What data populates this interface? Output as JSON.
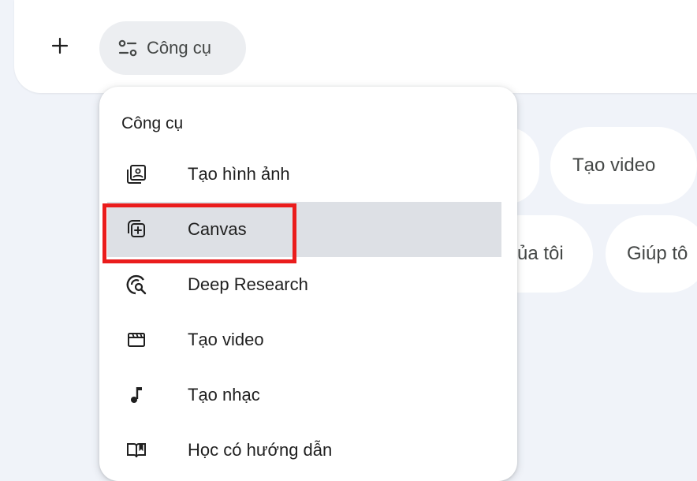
{
  "composer": {
    "plus_icon": "plus-icon",
    "tools_chip": {
      "icon": "tune-icon",
      "label": "Công cụ"
    }
  },
  "suggestions": [
    {
      "label": ""
    },
    {
      "label": "Tạo video"
    },
    {
      "label": "ủa tôi"
    },
    {
      "label": "Giúp tô"
    }
  ],
  "tools_menu": {
    "title": "Công cụ",
    "items": [
      {
        "label": "Tạo hình ảnh",
        "icon": "image-generation-icon"
      },
      {
        "label": "Canvas",
        "icon": "canvas-icon",
        "selected": true
      },
      {
        "label": "Deep Research",
        "icon": "deep-research-icon"
      },
      {
        "label": "Tạo video",
        "icon": "video-icon"
      },
      {
        "label": "Tạo nhạc",
        "icon": "music-note-icon"
      },
      {
        "label": "Học có hướng dẫn",
        "icon": "open-book-icon"
      }
    ]
  },
  "colors": {
    "background": "#f0f3f9",
    "menu_bg": "#ffffff",
    "selected_row": "#dde0e5",
    "highlight": "#ea1c1c",
    "chip_bg": "#eceef1",
    "text": "#1f1f1f"
  }
}
